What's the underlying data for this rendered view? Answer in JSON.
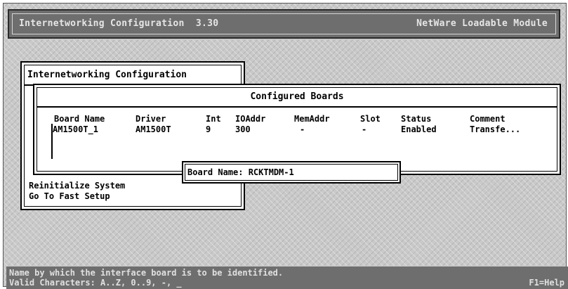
{
  "title_bar": {
    "left": "Internetworking Configuration  3.30",
    "right": "NetWare Loadable Module"
  },
  "menu": {
    "title": "Internetworking Configuration",
    "items": [
      "Reinitialize System",
      "Go To Fast Setup"
    ]
  },
  "configured_boards": {
    "title": "Configured Boards",
    "headers": [
      "Board Name",
      "Driver",
      "Int",
      "IOAddr",
      "MemAddr",
      "Slot",
      "Status",
      "Comment"
    ],
    "rows": [
      [
        "AM1500T_1",
        "AM1500T",
        "9",
        "300",
        "-",
        "-",
        "Enabled",
        "Transfe..."
      ]
    ]
  },
  "board_name_field": {
    "label": "Board Name: RCKTMDM-1"
  },
  "status_bar": {
    "line1": "Name by which the interface board is to be identified.",
    "line2": "Valid Characters: A..Z, 0..9, -, _",
    "help": "F1=Help"
  }
}
